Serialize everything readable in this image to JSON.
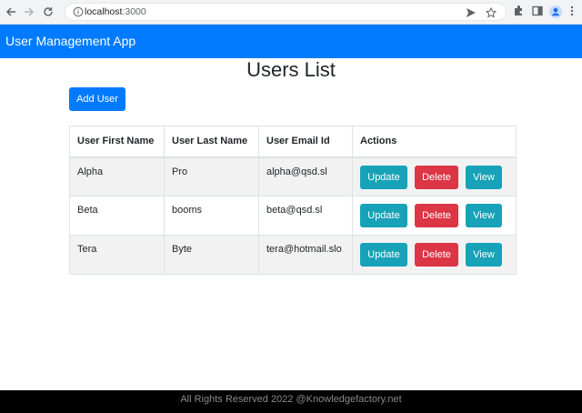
{
  "browser": {
    "url_host": "localhost",
    "url_port": ":3000"
  },
  "app": {
    "brand": "User Management App"
  },
  "page": {
    "title": "Users List",
    "add_label": "Add User"
  },
  "table": {
    "headers": [
      "User First Name",
      "User Last Name",
      "User Email Id",
      "Actions"
    ],
    "rows": [
      {
        "first": "Alpha",
        "last": "Pro",
        "email": "alpha@qsd.sl"
      },
      {
        "first": "Beta",
        "last": "booms",
        "email": "beta@qsd.sl"
      },
      {
        "first": "Tera",
        "last": "Byte",
        "email": "tera@hotmail.slo"
      }
    ],
    "action_labels": {
      "update": "Update",
      "delete": "Delete",
      "view": "View"
    }
  },
  "footer": {
    "text": "All Rights Reserved 2022 @Knowledgefactory.net"
  },
  "colors": {
    "primary": "#007bff",
    "info": "#17a2b8",
    "danger": "#dc3545"
  }
}
